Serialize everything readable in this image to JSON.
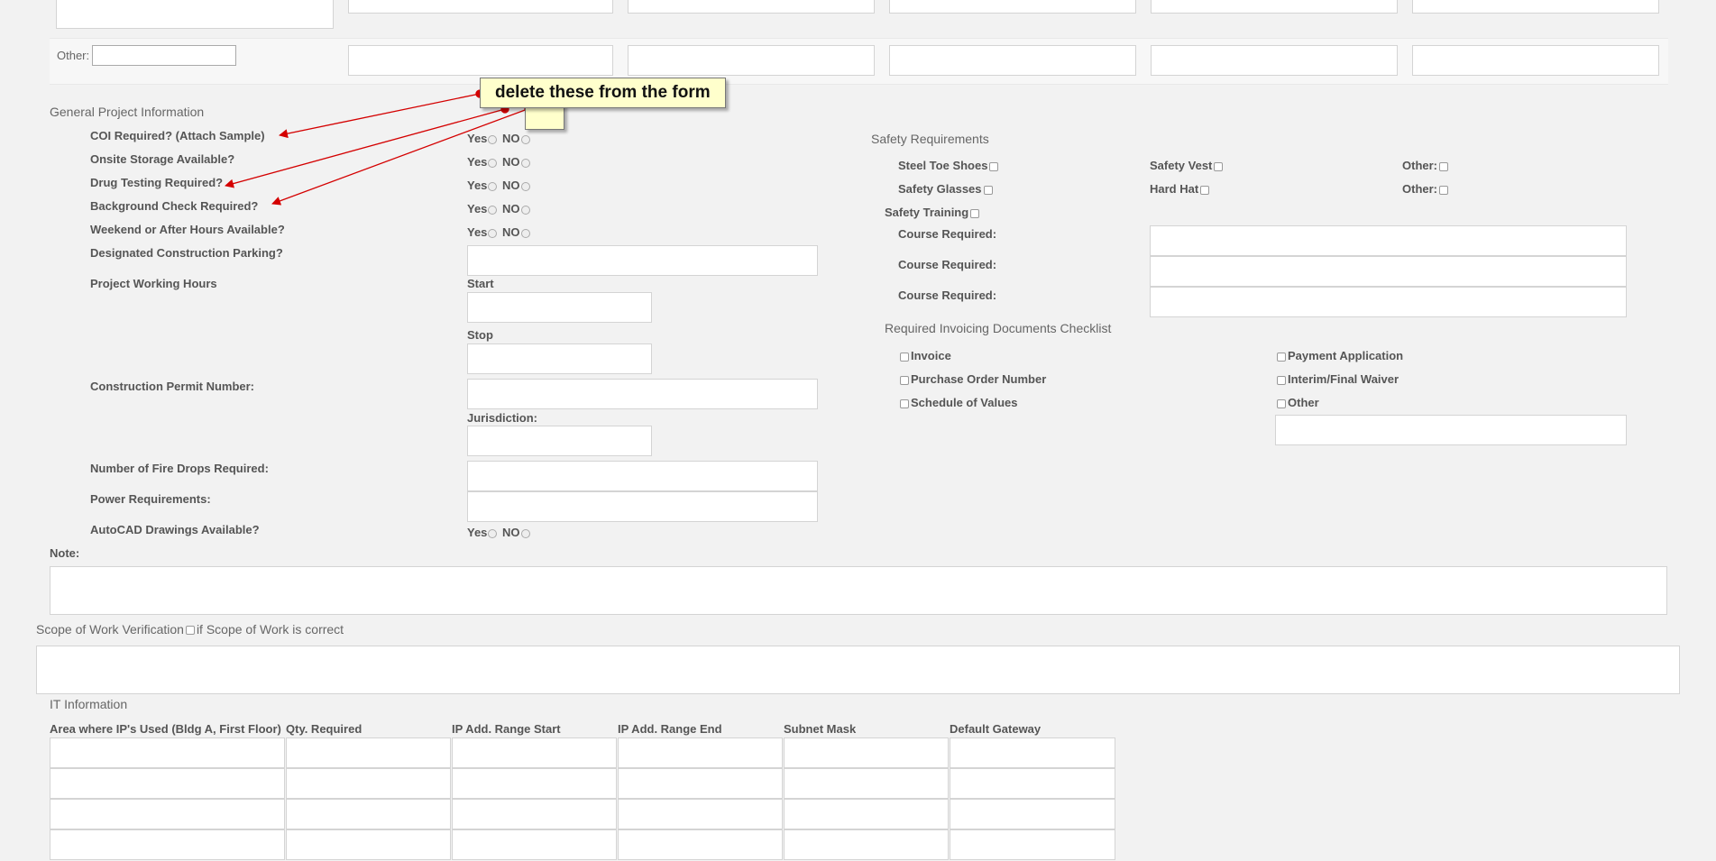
{
  "top_other": {
    "label": "Other:"
  },
  "callout": {
    "text": "delete these from the form"
  },
  "general": {
    "title": "General Project Information",
    "questions": [
      "COI Required? (Attach Sample)",
      "Onsite Storage Available?",
      "Drug Testing Required?",
      "Background Check Required?",
      "Weekend or After Hours Available?"
    ],
    "yes": "Yes",
    "no": "NO",
    "parking": "Designated Construction Parking?",
    "working_hours": "Project Working Hours",
    "start": "Start",
    "stop": "Stop",
    "permit": "Construction Permit Number:",
    "jurisdiction": "Jurisdiction:",
    "fire_drops": "Number of Fire Drops Required:",
    "power": "Power Requirements:",
    "autocad": "AutoCAD Drawings Available?",
    "note": "Note:"
  },
  "safety": {
    "title": "Safety Requirements",
    "steel_toe": "Steel Toe Shoes",
    "safety_vest": "Safety Vest",
    "other1": "Other:",
    "safety_glasses": "Safety Glasses",
    "hard_hat": "Hard Hat",
    "other2": "Other:",
    "training": "Safety Training",
    "course": "Course Required:"
  },
  "invoicing": {
    "title": "Required Invoicing Documents Checklist",
    "invoice": "Invoice",
    "po": "Purchase Order Number",
    "sov": "Schedule of Values",
    "payment": "Payment Application",
    "waiver": "Interim/Final Waiver",
    "other": "Other"
  },
  "scope": {
    "title": "Scope of Work Verification",
    "check_label": "if Scope of Work is correct"
  },
  "it": {
    "title": "IT Information",
    "columns": [
      "Area where IP's Used (Bldg A, First Floor)",
      "Qty. Required",
      "IP Add. Range Start",
      "IP Add. Range End",
      "Subnet Mask",
      "Default Gateway"
    ]
  }
}
